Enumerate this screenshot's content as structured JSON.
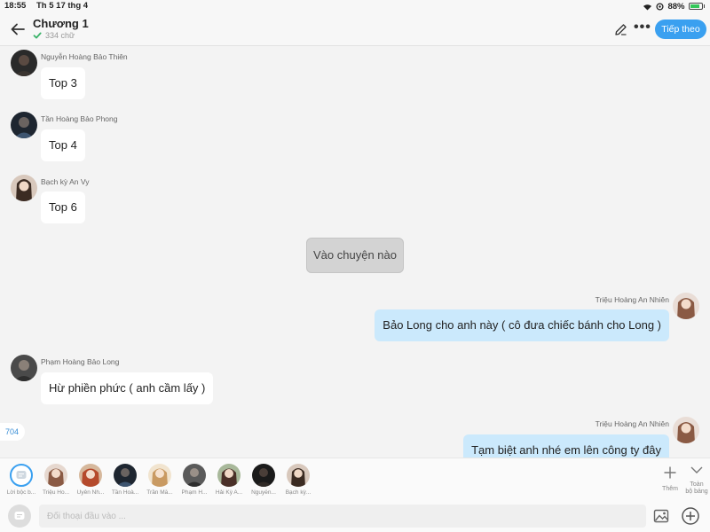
{
  "status_bar": {
    "time": "18:55",
    "date": "Th 5 17 thg 4",
    "battery": "88%"
  },
  "header": {
    "title": "Chương 1",
    "word_count": "334 chữ",
    "next_label": "Tiếp theo"
  },
  "messages": [
    {
      "sender": "Nguyễn Hoàng Bảo Thiên",
      "text": "Top 3",
      "side": "left"
    },
    {
      "sender": "Tần Hoàng Bảo Phong",
      "text": "Top 4",
      "side": "left"
    },
    {
      "sender": "Bạch kỳ An Vy",
      "text": "Top 6",
      "side": "left"
    },
    {
      "sender": "",
      "text": "Vào chuyện nào",
      "side": "narration"
    },
    {
      "sender": "Triệu Hoàng An Nhiên",
      "text": "Bảo Long cho anh này ( cô đưa chiếc bánh cho Long )",
      "side": "right"
    },
    {
      "sender": "Phạm Hoàng Bảo Long",
      "text": "Hừ phiền phức ( anh cầm lấy )",
      "side": "left"
    },
    {
      "sender": "Triệu Hoàng An Nhiên",
      "text": "Tạm biệt anh nhé em lên công ty đây",
      "side": "right"
    }
  ],
  "side_count": "704",
  "characters": [
    {
      "name": "Lời bộc b..."
    },
    {
      "name": "Triệu Ho..."
    },
    {
      "name": "Uyên Nh..."
    },
    {
      "name": "Tần Hoà..."
    },
    {
      "name": "Trần Mẫ..."
    },
    {
      "name": "Phạm H..."
    },
    {
      "name": "Hải Kỳ A..."
    },
    {
      "name": "Nguyễn..."
    },
    {
      "name": "Bạch kỳ..."
    }
  ],
  "tools": {
    "add_label": "Thêm",
    "expand_label_1": "Toàn",
    "expand_label_2": "bộ bảng"
  },
  "input": {
    "placeholder": "Đối thoại đầu vào ..."
  },
  "colors": {
    "accent": "#3aa0f0",
    "right_bubble": "#cbe9fc",
    "background": "#f3f3f3"
  },
  "icons": [
    "back-arrow-icon",
    "check-icon",
    "pencil-icon",
    "more-icon",
    "plus-icon",
    "chevron-down-icon",
    "chat-mode-icon",
    "image-icon",
    "plus-circle-icon"
  ]
}
